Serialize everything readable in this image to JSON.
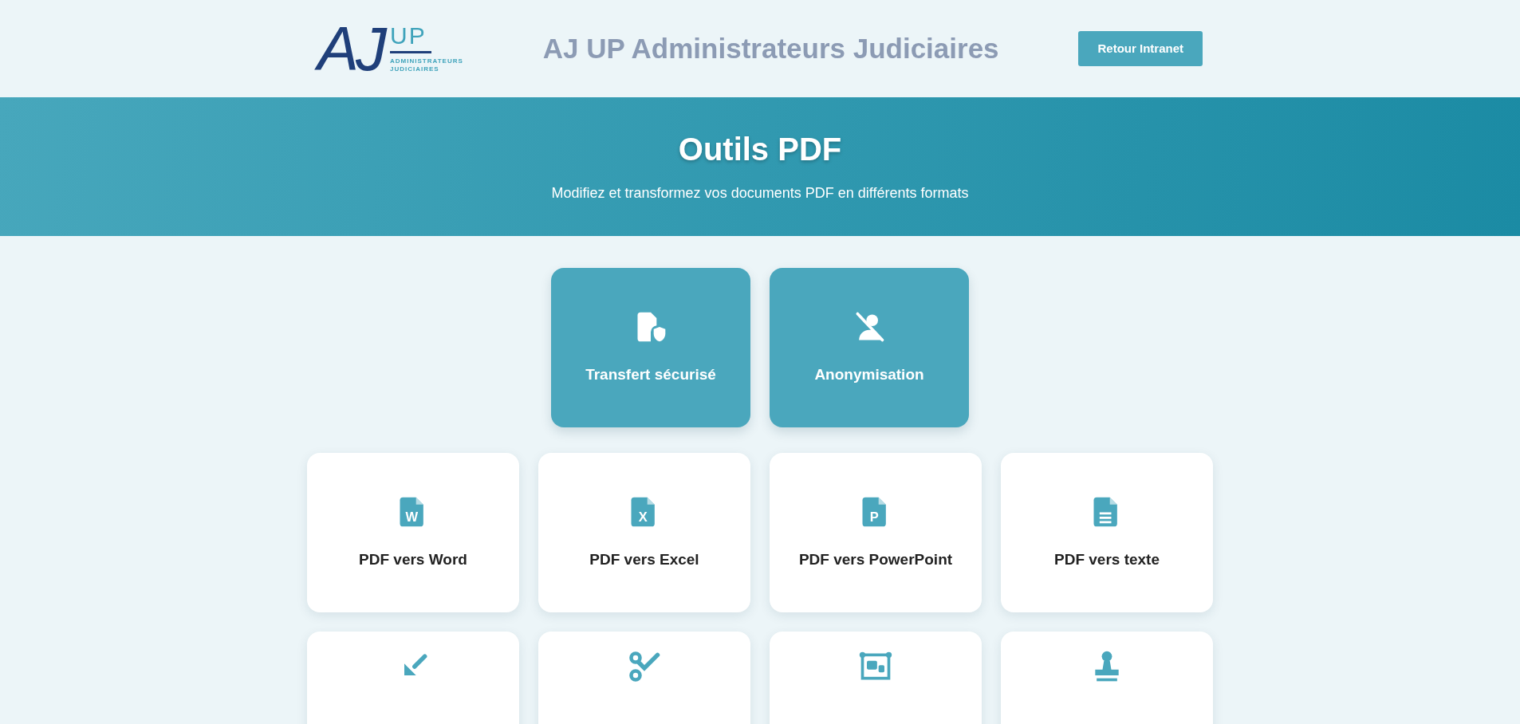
{
  "header": {
    "logo": {
      "mark": "AJ",
      "up": "UP",
      "line1": "ADMINISTRATEURS",
      "line2": "JUDICIAIRES"
    },
    "title": "AJ UP Administrateurs Judiciaires",
    "button": "Retour Intranet"
  },
  "banner": {
    "title": "Outils PDF",
    "subtitle": "Modifiez et transformez vos documents PDF en différents formats"
  },
  "featured": [
    {
      "label": "Transfert sécurisé",
      "kind": "secure-file"
    },
    {
      "label": "Anonymisation",
      "kind": "anonymize"
    }
  ],
  "tools": [
    {
      "label": "PDF vers Word",
      "kind": "file-letter",
      "letter": "W"
    },
    {
      "label": "PDF vers Excel",
      "kind": "file-letter",
      "letter": "X"
    },
    {
      "label": "PDF vers PowerPoint",
      "kind": "file-letter",
      "letter": "P"
    },
    {
      "label": "PDF vers texte",
      "kind": "file-lines"
    },
    {
      "kind": "compress"
    },
    {
      "kind": "scissors"
    },
    {
      "kind": "frame"
    },
    {
      "kind": "stamp"
    }
  ]
}
